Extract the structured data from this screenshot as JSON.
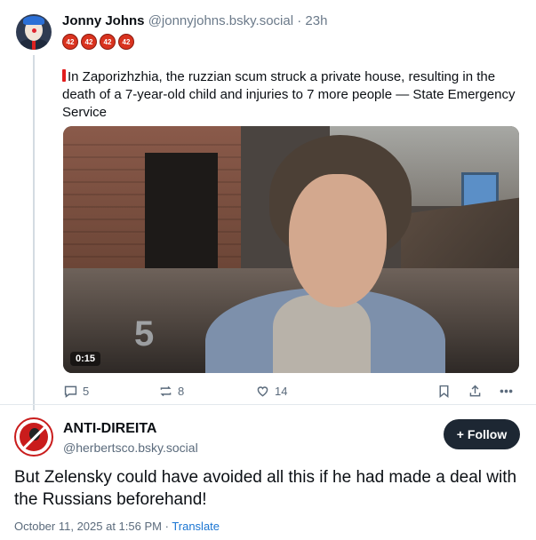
{
  "parent_post": {
    "display_name": "Jonny Johns",
    "handle": "@jonnyjohns.bsky.social",
    "separator": " · ",
    "time_ago": "23h",
    "badges": [
      "42",
      "42",
      "42",
      "42"
    ],
    "text": "In Zaporizhzhia, the ruzzian scum struck a private house, resulting in the death of a 7-year-old child and injuries to 7 more people — State Emergency Service",
    "video": {
      "duration": "0:15",
      "logo_text": "5"
    },
    "actions": {
      "replies": "5",
      "reposts": "8",
      "likes": "14"
    }
  },
  "reply_post": {
    "display_name": "ANTI-DIREITA",
    "handle": "@herbertsco.bsky.social",
    "follow_label": "Follow",
    "follow_icon": "+",
    "text": "But Zelensky could have avoided all this if he had made a deal with the Russians beforehand!",
    "timestamp": "October 11, 2025 at 1:56 PM",
    "meta_separator": " · ",
    "translate_label": "Translate"
  },
  "colors": {
    "accent_link": "#1a75d2",
    "follow_bg": "#1d2733",
    "muted_text": "#5b6b7c",
    "warning_red": "#e11d1d"
  }
}
